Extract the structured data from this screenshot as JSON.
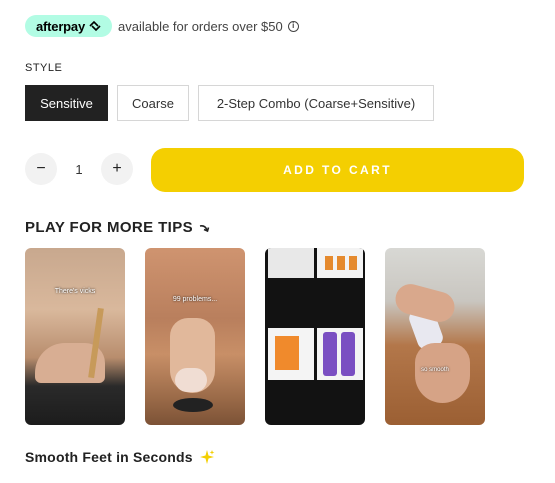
{
  "afterpay": {
    "brand": "afterpay",
    "message": "available for orders over $50",
    "brand_color": "#b2fce4"
  },
  "style": {
    "label": "STYLE",
    "options": [
      "Sensitive",
      "Coarse",
      "2-Step Combo (Coarse+Sensitive)"
    ],
    "selected": "Sensitive"
  },
  "quantity": {
    "minus": "−",
    "value": "1",
    "plus": "+"
  },
  "cart": {
    "label": "ADD TO CART",
    "color": "#f4cf01"
  },
  "tips": {
    "title": "PLAY FOR MORE TIPS",
    "icon": "curved-arrow-icon",
    "videos": [
      {
        "caption": "There's vicks"
      },
      {
        "caption": "99 problems..."
      },
      {
        "caption": ""
      },
      {
        "caption": "so smooth"
      }
    ]
  },
  "bottom": {
    "title": "Smooth Feet in Seconds",
    "icon": "sparkles-icon"
  }
}
